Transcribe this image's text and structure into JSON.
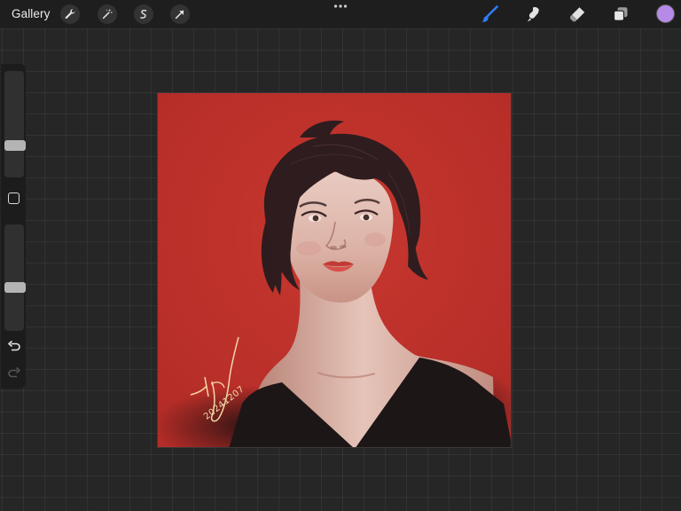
{
  "toolbar": {
    "gallery_label": "Gallery",
    "adjust_icons": [
      "wrench-icon",
      "magic-wand-icon",
      "selection-icon",
      "transform-arrow-icon"
    ],
    "right_tools": [
      "brush-icon",
      "smudge-icon",
      "eraser-icon",
      "layers-icon"
    ],
    "active_tool": "brush",
    "active_tool_color": "#2f7df6",
    "current_color": "#b68be8"
  },
  "sidebar": {
    "brush_size_level": 0.72,
    "opacity_level": 0.6
  },
  "canvas": {
    "background_color": "#c1312b",
    "signature_date": "20241207"
  }
}
